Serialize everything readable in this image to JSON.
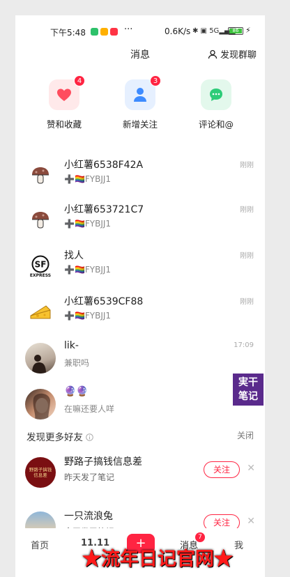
{
  "status_bar": {
    "time": "下午5:48",
    "more": "···",
    "speed": "0.6K/s",
    "signal": "5G",
    "battery": "86"
  },
  "header": {
    "title": "消息",
    "discover_group": "发现群聊"
  },
  "quick_entries": [
    {
      "label": "赞和收藏",
      "badge": "4",
      "icon": "heart-icon",
      "color": "#ff4d5e",
      "bg": "#ffe9ea"
    },
    {
      "label": "新增关注",
      "badge": "3",
      "icon": "person-icon",
      "color": "#3d8bff",
      "bg": "#e6f0ff"
    },
    {
      "label": "评论和@",
      "badge": "",
      "icon": "chat-icon",
      "color": "#2dcc78",
      "bg": "#e3f8ec"
    }
  ],
  "messages": [
    {
      "name": "小红薯6538F42A",
      "sub": "➕🏳️‍🌈FYBJJ1",
      "time": "刚刚",
      "avatar": "mushroom-avatar"
    },
    {
      "name": "小红薯653721C7",
      "sub": "➕🏳️‍🌈FYBJJ1",
      "time": "刚刚",
      "avatar": "mushroom-avatar"
    },
    {
      "name": "找人",
      "sub": "➕🏳️‍🌈FYBJJ1",
      "time": "刚刚",
      "avatar": "sf-express-avatar",
      "avatar_text": "SF",
      "avatar_caption": "EXPRESS"
    },
    {
      "name": "小红薯6539CF88",
      "sub": "➕🏳️‍🌈FYBJJ1",
      "time": "刚刚",
      "avatar": "cheese-avatar"
    },
    {
      "name": "lik-",
      "sub": "兼职吗",
      "time": "17:09",
      "avatar": "photo-avatar"
    },
    {
      "name": "🔮🔮",
      "sub": "在嘛还要人咩",
      "time": "",
      "avatar": "photo-avatar"
    }
  ],
  "discover": {
    "title": "发现更多好友",
    "close": "关闭",
    "items": [
      {
        "name": "野路子搞钱信息差",
        "sub": "昨天发了笔记",
        "button": "关注",
        "avatar_text": "野路子搞钱\n信息差"
      },
      {
        "name": "一只流浪兔",
        "sub": "今天发了笔记",
        "button": "关注"
      }
    ]
  },
  "tabbar": {
    "home": "首页",
    "event": "11.11",
    "add": "+",
    "messages": "消息",
    "messages_badge": "7",
    "me": "我"
  },
  "watermark": {
    "box_line1": "実干",
    "box_line2": "笔记",
    "banner": "★流年日记官网★"
  }
}
